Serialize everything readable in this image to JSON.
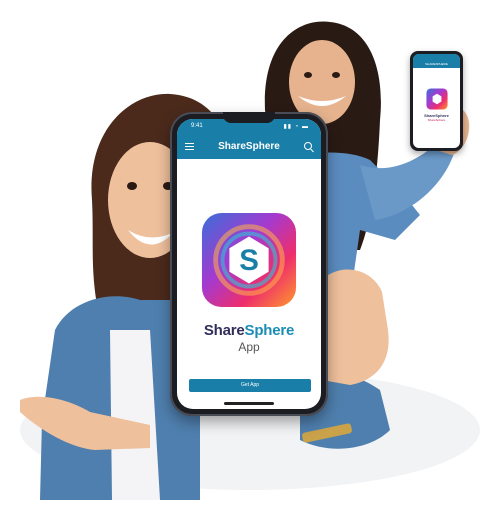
{
  "phone": {
    "status_time": "9:41",
    "status_icons": "▮▮ ◔ ▬",
    "app_title": "ShareSphere",
    "logo_letter": "S",
    "app_name_part1": "Share",
    "app_name_part2": "Sphere",
    "app_subtitle": "App",
    "cta_label": "Get App",
    "icons": [
      "menu-icon",
      "search-icon"
    ]
  },
  "small_phone": {
    "title": "SHARESPHERE",
    "app_name": "ShareSphere",
    "app_subtitle": "ShareSphere"
  },
  "colors": {
    "brand_blue": "#1a7fa8",
    "text_dark": "#2f2f5a",
    "logo_gradient": [
      "#3a6fd8",
      "#a43ad0",
      "#ee2e6c",
      "#ff9a2a"
    ]
  }
}
